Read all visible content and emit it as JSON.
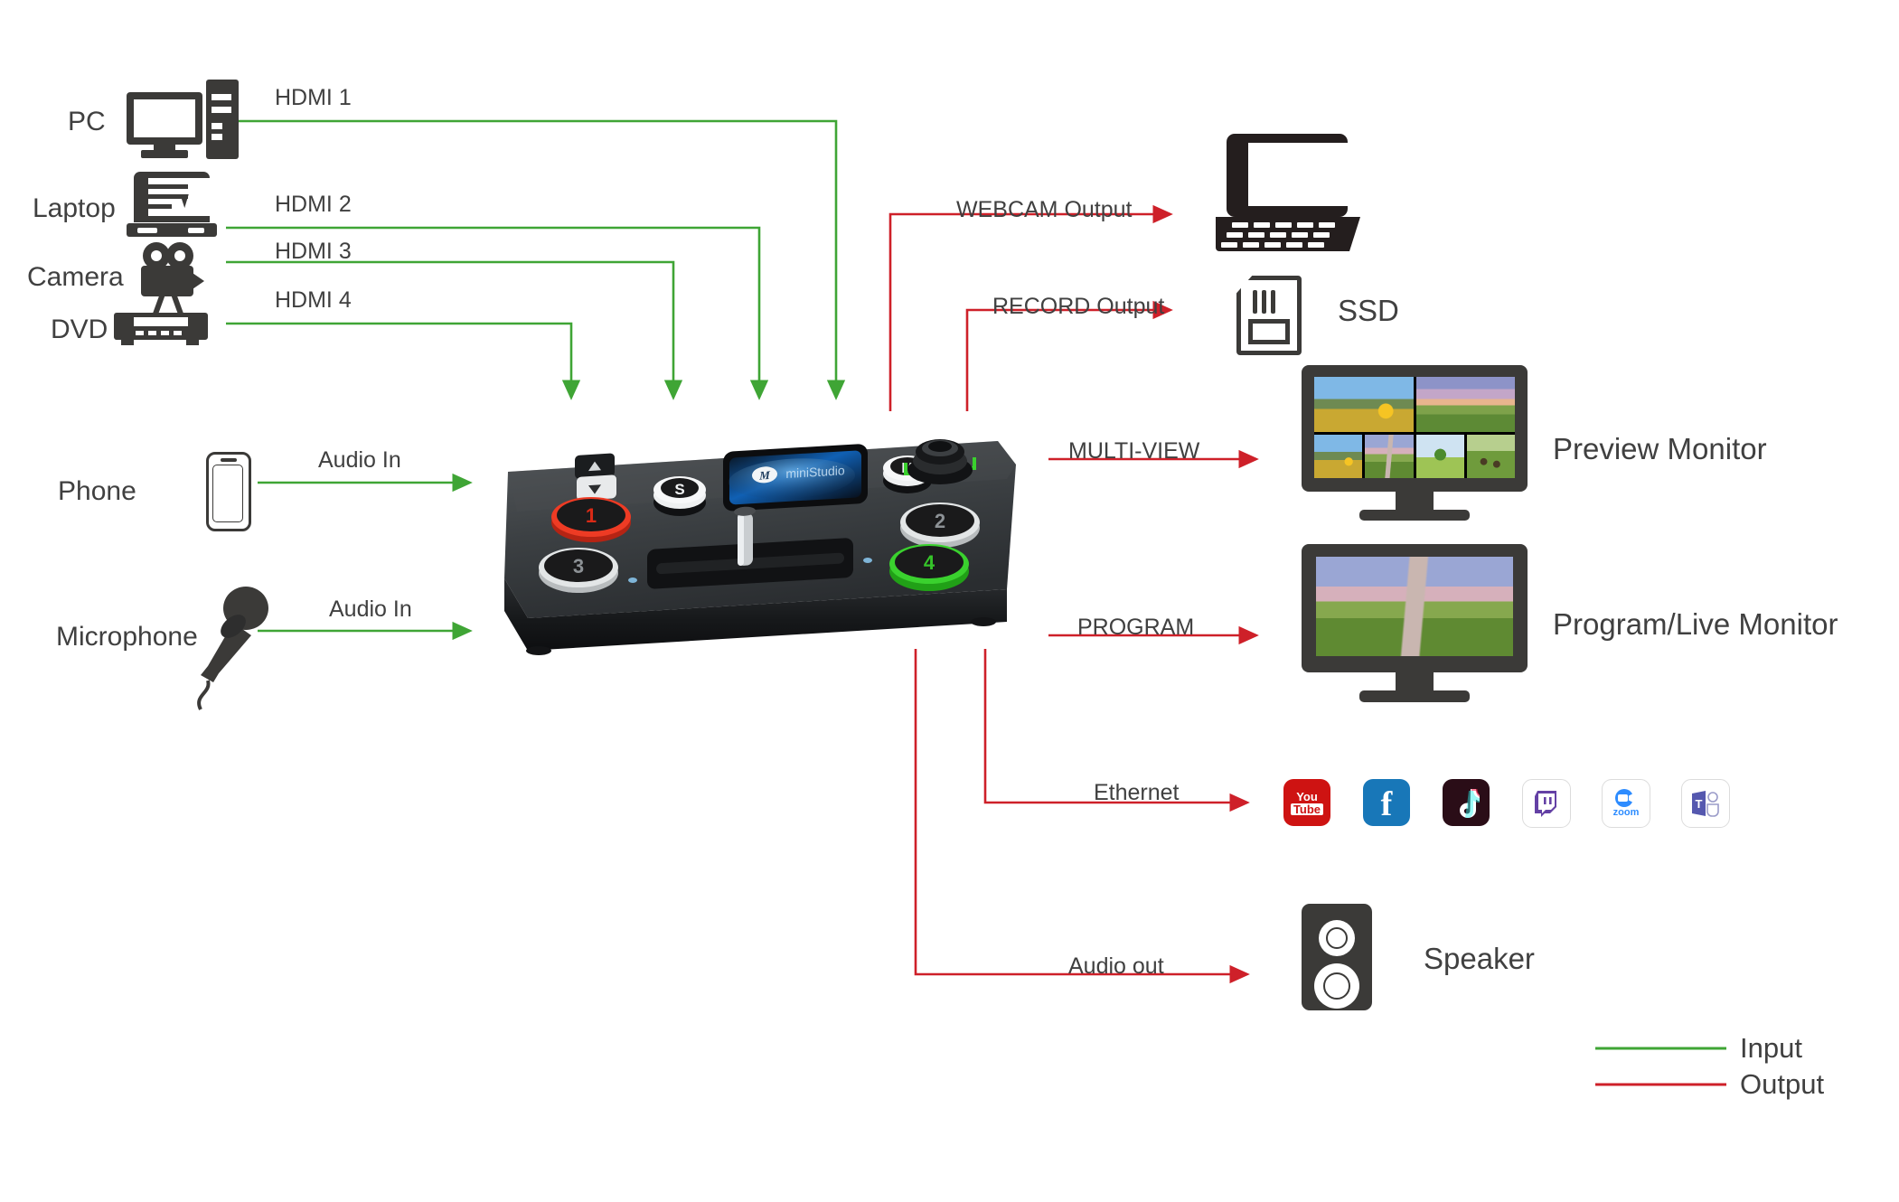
{
  "title": "Video Switcher Connection Diagram",
  "sources": [
    {
      "id": "pc",
      "label": "PC",
      "icon": "desktop-computer-icon",
      "link": "HDMI 1"
    },
    {
      "id": "laptop",
      "label": "Laptop",
      "icon": "laptop-icon",
      "link": "HDMI 2"
    },
    {
      "id": "camera",
      "label": "Camera",
      "icon": "video-camera-icon",
      "link": "HDMI 3"
    },
    {
      "id": "dvd",
      "label": "DVD",
      "icon": "dvd-player-icon",
      "link": "HDMI 4"
    },
    {
      "id": "phone",
      "label": "Phone",
      "icon": "smartphone-icon",
      "link": "Audio In"
    },
    {
      "id": "microphone",
      "label": "Microphone",
      "icon": "microphone-icon",
      "link": "Audio In"
    }
  ],
  "outputs": [
    {
      "id": "webcam",
      "link": "WEBCAM Output",
      "target": "",
      "icon": "laptop-icon"
    },
    {
      "id": "record",
      "link": "RECORD Output",
      "target": "SSD",
      "icon": "ssd-card-icon"
    },
    {
      "id": "multiview",
      "link": "MULTI-VIEW",
      "target": "Preview Monitor",
      "icon": "monitor-icon"
    },
    {
      "id": "program",
      "link": "PROGRAM",
      "target": "Program/Live Monitor",
      "icon": "monitor-icon"
    },
    {
      "id": "ethernet",
      "link": "Ethernet",
      "target": "",
      "icon": "streaming-platforms-icon"
    },
    {
      "id": "audioout",
      "link": "Audio out",
      "target": "Speaker",
      "icon": "speaker-icon"
    }
  ],
  "platforms": [
    {
      "name": "YouTube",
      "text": "You",
      "text2": "Tube",
      "bg": "#CE1312",
      "fg": "#ffffff"
    },
    {
      "name": "Facebook",
      "text": "f",
      "text2": "",
      "bg": "#1877B8",
      "fg": "#ffffff"
    },
    {
      "name": "TikTok",
      "text": "♪",
      "text2": "",
      "bg": "#2a0d17",
      "fg": "#ffffff"
    },
    {
      "name": "Twitch",
      "text": "",
      "text2": "",
      "bg": "#ffffff",
      "fg": "#6441A5"
    },
    {
      "name": "Zoom",
      "text": "zoom",
      "text2": "",
      "bg": "#ffffff",
      "fg": "#2D8CFF"
    },
    {
      "name": "Teams",
      "text": "T",
      "text2": "",
      "bg": "#ffffff",
      "fg": "#5558AF"
    }
  ],
  "device": {
    "name": "video-switcher",
    "brand": "miniStudio",
    "buttons": [
      {
        "id": "1",
        "label": "1",
        "color": "#ee3b24",
        "state": "program"
      },
      {
        "id": "2",
        "label": "2",
        "color": "#d9dcdd",
        "state": "idle"
      },
      {
        "id": "3",
        "label": "3",
        "color": "#d9dcdd",
        "state": "idle"
      },
      {
        "id": "4",
        "label": "4",
        "color": "#3ad12e",
        "state": "preview"
      }
    ],
    "knob_label": "S",
    "knob_label_right": "M"
  },
  "legend": {
    "items": [
      {
        "label": "Input",
        "color": "#3FA535"
      },
      {
        "label": "Output",
        "color": "#E02020"
      }
    ]
  },
  "colors": {
    "input_line": "#3FA535",
    "output_line": "#CE2029",
    "icon_dark": "#3b3a38",
    "text": "#404040"
  }
}
